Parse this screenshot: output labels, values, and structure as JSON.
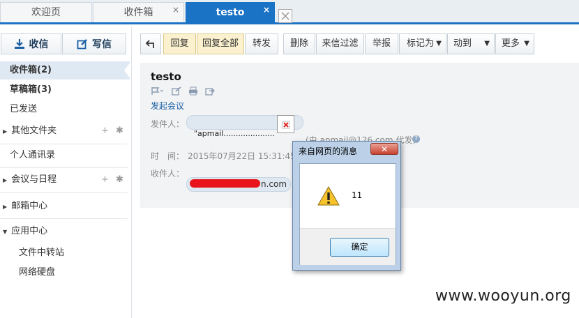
{
  "tabs": [
    {
      "label": "欢迎页"
    },
    {
      "label": "收件箱",
      "close": "×"
    },
    {
      "label": "testo",
      "close": "×"
    }
  ],
  "sidebar": {
    "receive_label": "收信",
    "compose_label": "写信",
    "items": [
      {
        "label": "收件箱(2)"
      },
      {
        "label": "草稿箱(3)"
      },
      {
        "label": "已发送"
      },
      {
        "label": "其他文件夹"
      },
      {
        "label": "个人通讯录"
      },
      {
        "label": "会议与日程"
      },
      {
        "label": "邮箱中心"
      },
      {
        "label": "应用中心"
      },
      {
        "label": "文件中转站"
      },
      {
        "label": "网络硬盘"
      }
    ]
  },
  "toolbar": {
    "reply": "回复",
    "reply_all": "回复全部",
    "forward": "转发",
    "delete": "删除",
    "filter": "来信过滤",
    "report": "举报",
    "mark_as": "标记为",
    "move_to": "动到",
    "more": "更多"
  },
  "mail": {
    "subject": "testo",
    "meeting_link": "发起会议",
    "from_label": "发件人：",
    "from_value": "\"apmail.....................",
    "sender_hint": "(由 apmail@126.com 代发)",
    "time_label": "时　间：",
    "time_value": "2015年07月22日 15:31:45 (",
    "to_label": "收件人：",
    "to_suffix": "n.com"
  },
  "dialog": {
    "title": "来自网页的消息",
    "message": "11",
    "ok": "确定"
  },
  "watermark": "www.wooyun.org",
  "colors": {
    "accent": "#1b73c5",
    "redaction": "#e8131b"
  }
}
